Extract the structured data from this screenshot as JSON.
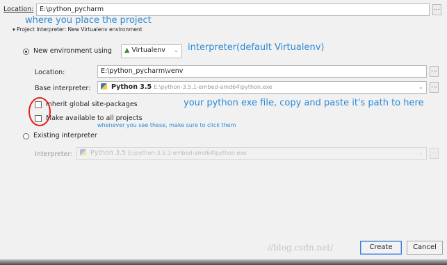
{
  "top": {
    "location_label": "Location:",
    "location_value": "E:\\python_pycharm",
    "browse": "..."
  },
  "annotations": {
    "where_project": "where you place the project",
    "interpreter_note": "interpreter(default Virtualenv)",
    "exe_path_note": "your python exe file, copy and paste it's path to here",
    "click_note": "whenever you see these, make sure to click them"
  },
  "section": {
    "title": "Project Interpreter: New Virtualenv environment"
  },
  "new_env": {
    "radio_label": "New environment using",
    "tool_value": "Virtualenv",
    "location_label": "Location:",
    "location_value": "E:\\python_pycharm\\venv",
    "base_label": "Base interpreter:",
    "base_name": "Python 3.5",
    "base_path": "E:\\python-3.5.1-embed-amd64\\python.exe",
    "inherit_label": "Inherit global site-packages",
    "make_available_label": "Make available to all projects"
  },
  "existing": {
    "radio_label": "Existing interpreter",
    "interpreter_label": "Interpreter:",
    "interp_name": "Python 3.5",
    "interp_path": "E:\\python-3.5.1-embed-amd64\\python.exe"
  },
  "footer": {
    "watermark": "//blog.csdn.net/",
    "create": "Create",
    "cancel": "Cancel"
  },
  "colors": {
    "annotation_blue": "#2d8ad6",
    "circle_red": "#e02020",
    "background": "#f1f1f1"
  }
}
